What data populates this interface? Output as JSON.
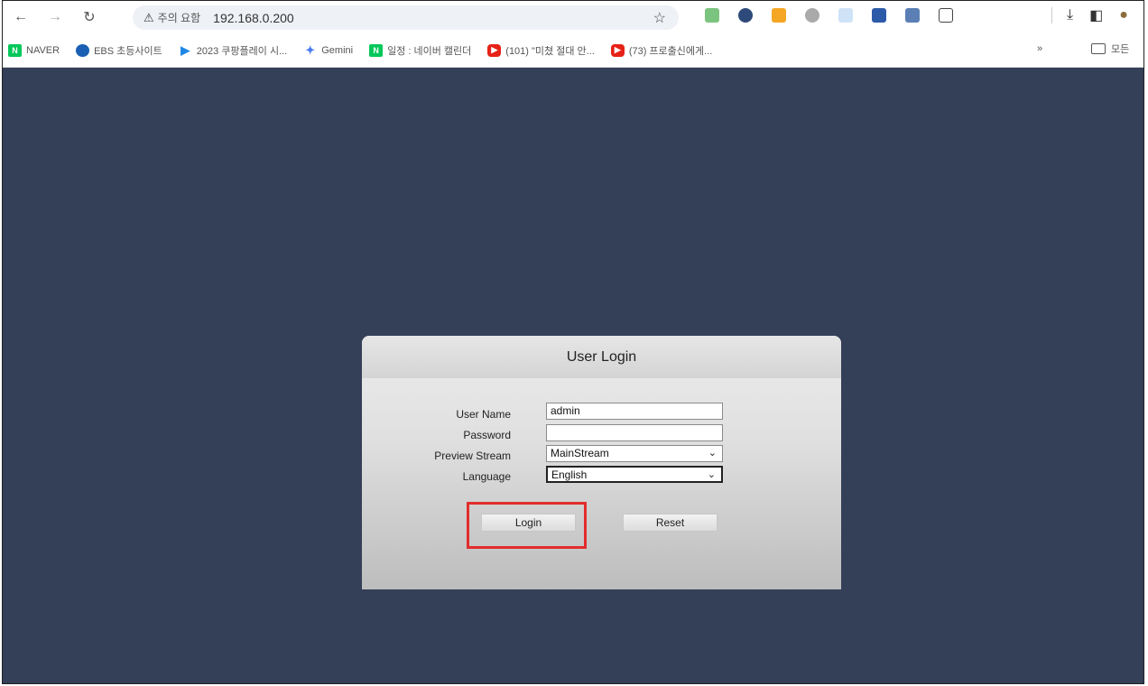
{
  "browser": {
    "address_warning": "주의 요함",
    "url": "192.168.0.200",
    "bookmarks": [
      {
        "label": "NAVER",
        "icon": "naver-icon",
        "color": "#03c75a"
      },
      {
        "label": "EBS 초등사이트",
        "icon": "ebs-icon",
        "color": "#1a5fb4"
      },
      {
        "label": "2023 쿠팡플레이 시...",
        "icon": "coupang-play-icon",
        "color": "#1e88e5"
      },
      {
        "label": "Gemini",
        "icon": "gemini-icon",
        "color": "#4a7cf0"
      },
      {
        "label": "일정 : 네이버 캘린더",
        "icon": "naver-calendar-icon",
        "color": "#03c75a"
      },
      {
        "label": "(101) \"미쳤 절대 안...",
        "icon": "youtube-icon",
        "color": "#e62117"
      },
      {
        "label": "(73) 프로출신에게...",
        "icon": "youtube-icon",
        "color": "#e62117"
      }
    ],
    "more_label": "»",
    "folder_label": "모든"
  },
  "login": {
    "title": "User Login",
    "username_label": "User Name",
    "username_value": "admin",
    "password_label": "Password",
    "password_value": "",
    "stream_label": "Preview Stream",
    "stream_value": "MainStream",
    "language_label": "Language",
    "language_value": "English",
    "login_button": "Login",
    "reset_button": "Reset"
  },
  "colors": {
    "page_background": "#343f58",
    "highlight": "#e32c2c"
  }
}
